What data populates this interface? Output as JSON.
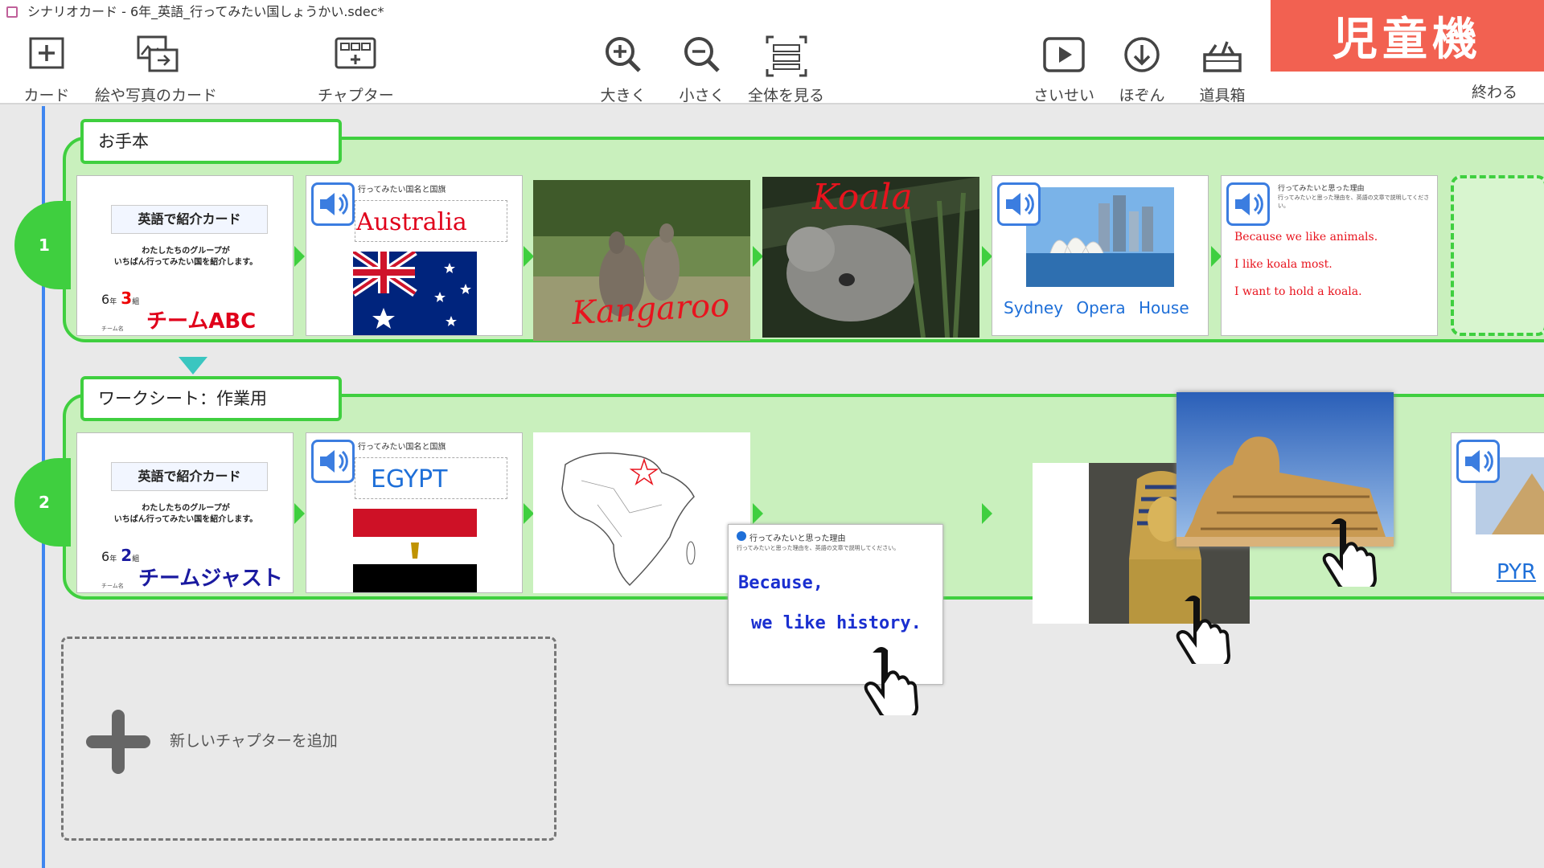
{
  "window": {
    "title": "シナリオカード - 6年_英語_行ってみたい国しょうかい.sdec*"
  },
  "toolbar": {
    "card_label": "カード",
    "picture_card_label": "絵や写真のカード",
    "chapter_label": "チャプター",
    "zoom_in_label": "大きく",
    "zoom_out_label": "小さく",
    "fit_label": "全体を見る",
    "play_label": "さいせい",
    "save_label": "ほぞん",
    "tools_label": "道具箱",
    "exit_label": "終わる",
    "mode_badge": "児童機"
  },
  "chapters": [
    {
      "number": "1",
      "title": "お手本",
      "intro": {
        "heading": "英語で紹介カード",
        "line1": "わたしたちのグループが",
        "line2": "いちばん行ってみたい国を紹介します。",
        "grade": "6",
        "grade_unit": "年",
        "class": "3",
        "class_unit": "組",
        "team": "チームABC",
        "team_label": "チーム名"
      },
      "country": {
        "heading": "行ってみたい国名と国旗",
        "name": "Australia"
      },
      "photo1_caption": "Kangaroo",
      "photo2_caption": "Koala",
      "landmark_caption": "Sydney Opera House",
      "reason": {
        "heading": "行ってみたいと思った理由",
        "sub": "行ってみたいと思った理由を、英語の文章で説明してください。",
        "lines": [
          "Because we like animals.",
          "I like koala most.",
          "I want to hold a koala."
        ]
      }
    },
    {
      "number": "2",
      "title": "ワークシート：作業用",
      "intro": {
        "heading": "英語で紹介カード",
        "line1": "わたしたちのグループが",
        "line2": "いちばん行ってみたい国を紹介します。",
        "grade": "6",
        "grade_unit": "年",
        "class": "2",
        "class_unit": "組",
        "team": "チームジャスト",
        "team_label": "チーム名"
      },
      "country": {
        "heading": "行ってみたい国名と国旗",
        "name": "EGYPT"
      },
      "reason": {
        "heading": "行ってみたいと思った理由",
        "sub": "行ってみたいと思った理由を、英語の文章で説明してください。",
        "lines": [
          "Because,",
          "we like history."
        ]
      },
      "partial_caption": "PYR"
    }
  ],
  "new_chapter_label": "新しいチャプターを追加",
  "colors": {
    "accent_green": "#3fcf3f",
    "timeline_blue": "#3f86f0",
    "badge_red": "#f26151"
  }
}
